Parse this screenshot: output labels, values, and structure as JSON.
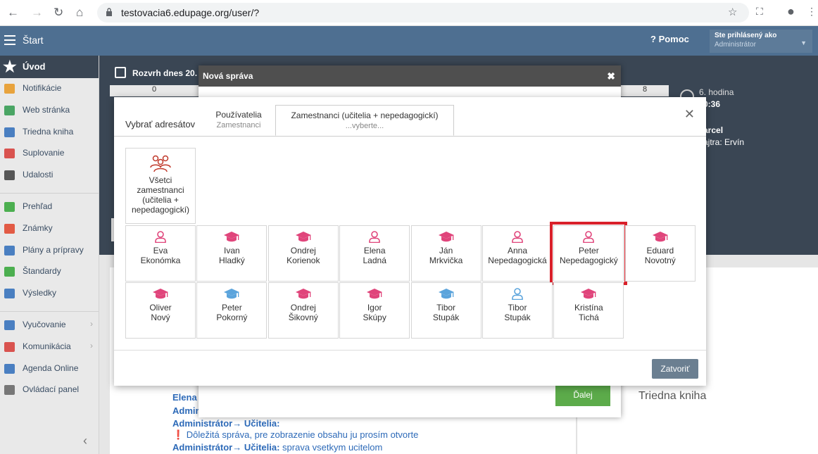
{
  "browser": {
    "url": "testovacia6.edupage.org/user/?"
  },
  "header": {
    "menu_label": "Štart",
    "help_label": "Pomoc",
    "logged_as": "Ste prihlásený ako",
    "user": "Administrátor"
  },
  "sidebar": {
    "home": "Úvod",
    "groups": [
      [
        {
          "label": "Notifikácie",
          "icon": "envelope-icon",
          "color": "#e8a33d"
        },
        {
          "label": "Web stránka",
          "icon": "home-icon",
          "color": "#4aa564"
        },
        {
          "label": "Triedna kniha",
          "icon": "book-icon",
          "color": "#4a7fc1"
        },
        {
          "label": "Suplovanie",
          "icon": "person-icon",
          "color": "#d9534f"
        },
        {
          "label": "Udalosti",
          "icon": "calendar-icon",
          "color": "#555555"
        }
      ],
      [
        {
          "label": "Prehľad",
          "icon": "check-circle-icon",
          "color": "#4caf50"
        },
        {
          "label": "Známky",
          "icon": "grade-icon",
          "color": "#e25b45"
        },
        {
          "label": "Plány a prípravy",
          "icon": "briefcase-icon",
          "color": "#4a7fc1"
        },
        {
          "label": "Štandardy",
          "icon": "shield-icon",
          "color": "#4caf50"
        },
        {
          "label": "Výsledky",
          "icon": "bar-chart-icon",
          "color": "#4a7fc1"
        }
      ],
      [
        {
          "label": "Vyučovanie",
          "icon": "bag-icon",
          "color": "#4a7fc1"
        },
        {
          "label": "Komunikácia",
          "icon": "chat-icon",
          "color": "#d9534f"
        },
        {
          "label": "Agenda Online",
          "icon": "pen-icon",
          "color": "#4a7fc1"
        },
        {
          "label": "Ovládací panel",
          "icon": "gear-icon",
          "color": "#777777"
        }
      ]
    ]
  },
  "background": {
    "schedule_title": "Rozvrh dnes 20.",
    "period0": "0",
    "period8": "8",
    "lesson": "6. hodina",
    "time": "0:36",
    "teacher_name": "arcel",
    "teacher_sub": "ajtra: Ervín",
    "triedna_kniha": "Triedna kniha",
    "msgs": [
      {
        "from": "Elena",
        "text": ""
      },
      {
        "from": "Admin",
        "text": ""
      },
      {
        "from": "Administrátor→ Učitelia:",
        "text": ""
      },
      {
        "from": "",
        "text": "❗ Dôležitá správa, pre zobrazenie obsahu ju prosím otvorte"
      },
      {
        "from": "Administrátor→ Učitelia:",
        "text": " sprava vsetkym ucitelom"
      }
    ]
  },
  "nova": {
    "title": "Nová správa",
    "next_label": "Ďalej"
  },
  "dialog": {
    "title": "Vybrať adresátov",
    "tabs": [
      {
        "label": "Používatelia",
        "sub": "Zamestnanci"
      },
      {
        "label": "Zamestnanci (učitelia + nepedagogickí)",
        "sub": "...vyberte..."
      }
    ],
    "all_label": "Všetci zamestnanci (učitelia + nepedagogickí)",
    "people": [
      {
        "first": "Eva",
        "last": "Ekonómka",
        "icon": "person-outline-icon",
        "color": "#e0457b"
      },
      {
        "first": "Ivan",
        "last": "Hladký",
        "icon": "graduation-cap-icon",
        "color": "#e0457b"
      },
      {
        "first": "Ondrej",
        "last": "Korienok",
        "icon": "graduation-cap-icon",
        "color": "#e0457b"
      },
      {
        "first": "Elena",
        "last": "Ladná",
        "icon": "person-outline-icon",
        "color": "#e0457b"
      },
      {
        "first": "Ján",
        "last": "Mrkvička",
        "icon": "graduation-cap-icon",
        "color": "#e0457b"
      },
      {
        "first": "Anna",
        "last": "Nepedagogická",
        "icon": "person-outline-icon",
        "color": "#e0457b"
      },
      {
        "first": "Peter",
        "last": "Nepedagogický",
        "icon": "person-outline-icon",
        "color": "#e0457b",
        "selected": true
      },
      {
        "first": "Eduard",
        "last": "Novotný",
        "icon": "graduation-cap-icon",
        "color": "#e0457b"
      },
      {
        "first": "Oliver",
        "last": "Nový",
        "icon": "graduation-cap-icon",
        "color": "#e0457b"
      },
      {
        "first": "Peter",
        "last": "Pokorný",
        "icon": "graduation-cap-icon",
        "color": "#5ba4dc"
      },
      {
        "first": "Ondrej",
        "last": "Šikovný",
        "icon": "graduation-cap-icon",
        "color": "#e0457b"
      },
      {
        "first": "Igor",
        "last": "Skúpy",
        "icon": "graduation-cap-icon",
        "color": "#e0457b"
      },
      {
        "first": "Tibor",
        "last": "Stupák",
        "icon": "graduation-cap-icon",
        "color": "#5ba4dc"
      },
      {
        "first": "Tibor",
        "last": "Stupák",
        "icon": "person-outline-icon",
        "color": "#5ba4dc"
      },
      {
        "first": "Kristína",
        "last": "Tichá",
        "icon": "graduation-cap-icon",
        "color": "#e0457b"
      }
    ],
    "close_label": "Zatvoriť"
  }
}
